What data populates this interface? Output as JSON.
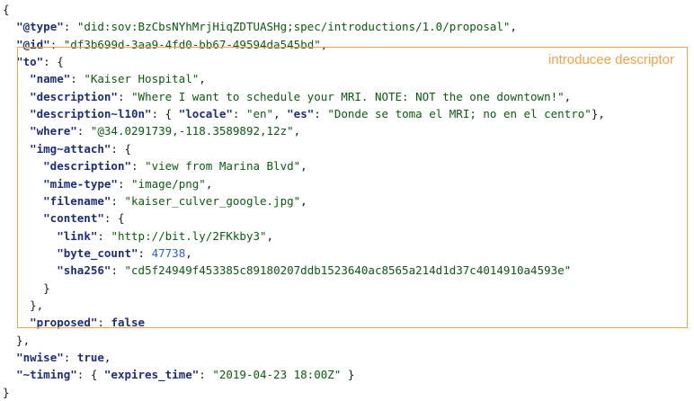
{
  "annotation": {
    "label": "introducee descriptor",
    "color": "#f0a24b"
  },
  "colors": {
    "key": "#1c2e7a",
    "string": "#0b5a0f",
    "number": "#2b5fd9",
    "literal": "#1c2e7a",
    "punct": "#1a1a1a"
  },
  "code": {
    "lines": [
      [
        {
          "t": "p",
          "v": "{"
        }
      ],
      [
        {
          "t": "p",
          "v": "  "
        },
        {
          "t": "k",
          "v": "\"@type\""
        },
        {
          "t": "p",
          "v": ": "
        },
        {
          "t": "s",
          "v": "\"did:sov:BzCbsNYhMrjHiqZDTUASHg;spec/introductions/1.0/proposal\""
        },
        {
          "t": "p",
          "v": ","
        }
      ],
      [
        {
          "t": "p",
          "v": "  "
        },
        {
          "t": "k",
          "v": "\"@id\""
        },
        {
          "t": "p",
          "v": ": "
        },
        {
          "t": "s",
          "v": "\"df3b699d-3aa9-4fd0-bb67-49594da545bd\""
        },
        {
          "t": "p",
          "v": ","
        }
      ],
      [
        {
          "t": "p",
          "v": "  "
        },
        {
          "t": "k",
          "v": "\"to\""
        },
        {
          "t": "p",
          "v": ": {"
        }
      ],
      [
        {
          "t": "p",
          "v": "    "
        },
        {
          "t": "k",
          "v": "\"name\""
        },
        {
          "t": "p",
          "v": ": "
        },
        {
          "t": "s",
          "v": "\"Kaiser Hospital\""
        },
        {
          "t": "p",
          "v": ","
        }
      ],
      [
        {
          "t": "p",
          "v": "    "
        },
        {
          "t": "k",
          "v": "\"description\""
        },
        {
          "t": "p",
          "v": ": "
        },
        {
          "t": "s",
          "v": "\"Where I want to schedule your MRI. NOTE: NOT the one downtown!\""
        },
        {
          "t": "p",
          "v": ","
        }
      ],
      [
        {
          "t": "p",
          "v": "    "
        },
        {
          "t": "k",
          "v": "\"description~l10n\""
        },
        {
          "t": "p",
          "v": ": { "
        },
        {
          "t": "k",
          "v": "\"locale\""
        },
        {
          "t": "p",
          "v": ": "
        },
        {
          "t": "s",
          "v": "\"en\""
        },
        {
          "t": "p",
          "v": ", "
        },
        {
          "t": "k",
          "v": "\"es\""
        },
        {
          "t": "p",
          "v": ": "
        },
        {
          "t": "s",
          "v": "\"Donde se toma el MRI; no en el centro\""
        },
        {
          "t": "p",
          "v": "},"
        }
      ],
      [
        {
          "t": "p",
          "v": "    "
        },
        {
          "t": "k",
          "v": "\"where\""
        },
        {
          "t": "p",
          "v": ": "
        },
        {
          "t": "s",
          "v": "\"@34.0291739,-118.3589892,12z\""
        },
        {
          "t": "p",
          "v": ","
        }
      ],
      [
        {
          "t": "p",
          "v": "    "
        },
        {
          "t": "k",
          "v": "\"img~attach\""
        },
        {
          "t": "p",
          "v": ": {"
        }
      ],
      [
        {
          "t": "p",
          "v": "      "
        },
        {
          "t": "k",
          "v": "\"description\""
        },
        {
          "t": "p",
          "v": ": "
        },
        {
          "t": "s",
          "v": "\"view from Marina Blvd\""
        },
        {
          "t": "p",
          "v": ","
        }
      ],
      [
        {
          "t": "p",
          "v": "      "
        },
        {
          "t": "k",
          "v": "\"mime-type\""
        },
        {
          "t": "p",
          "v": ": "
        },
        {
          "t": "s",
          "v": "\"image/png\""
        },
        {
          "t": "p",
          "v": ","
        }
      ],
      [
        {
          "t": "p",
          "v": "      "
        },
        {
          "t": "k",
          "v": "\"filename\""
        },
        {
          "t": "p",
          "v": ": "
        },
        {
          "t": "s",
          "v": "\"kaiser_culver_google.jpg\""
        },
        {
          "t": "p",
          "v": ","
        }
      ],
      [
        {
          "t": "p",
          "v": "      "
        },
        {
          "t": "k",
          "v": "\"content\""
        },
        {
          "t": "p",
          "v": ": {"
        }
      ],
      [
        {
          "t": "p",
          "v": "        "
        },
        {
          "t": "k",
          "v": "\"link\""
        },
        {
          "t": "p",
          "v": ": "
        },
        {
          "t": "s",
          "v": "\"http://bit.ly/2FKkby3\""
        },
        {
          "t": "p",
          "v": ","
        }
      ],
      [
        {
          "t": "p",
          "v": "        "
        },
        {
          "t": "k",
          "v": "\"byte_count\""
        },
        {
          "t": "p",
          "v": ": "
        },
        {
          "t": "n",
          "v": "47738"
        },
        {
          "t": "p",
          "v": ","
        }
      ],
      [
        {
          "t": "p",
          "v": "        "
        },
        {
          "t": "k",
          "v": "\"sha256\""
        },
        {
          "t": "p",
          "v": ": "
        },
        {
          "t": "s",
          "v": "\"cd5f24949f453385c89180207ddb1523640ac8565a214d1d37c4014910a4593e\""
        }
      ],
      [
        {
          "t": "p",
          "v": "      }"
        }
      ],
      [
        {
          "t": "p",
          "v": "    },"
        }
      ],
      [
        {
          "t": "p",
          "v": "    "
        },
        {
          "t": "k",
          "v": "\"proposed\""
        },
        {
          "t": "p",
          "v": ": "
        },
        {
          "t": "lit",
          "v": "false"
        }
      ],
      [
        {
          "t": "p",
          "v": "  },"
        }
      ],
      [
        {
          "t": "p",
          "v": "  "
        },
        {
          "t": "k",
          "v": "\"nwise\""
        },
        {
          "t": "p",
          "v": ": "
        },
        {
          "t": "lit",
          "v": "true"
        },
        {
          "t": "p",
          "v": ","
        }
      ],
      [
        {
          "t": "p",
          "v": "  "
        },
        {
          "t": "k",
          "v": "\"~timing\""
        },
        {
          "t": "p",
          "v": ": { "
        },
        {
          "t": "k",
          "v": "\"expires_time\""
        },
        {
          "t": "p",
          "v": ": "
        },
        {
          "t": "s",
          "v": "\"2019-04-23 18:00Z\""
        },
        {
          "t": "p",
          "v": " }"
        }
      ],
      [
        {
          "t": "p",
          "v": "}"
        }
      ]
    ]
  }
}
